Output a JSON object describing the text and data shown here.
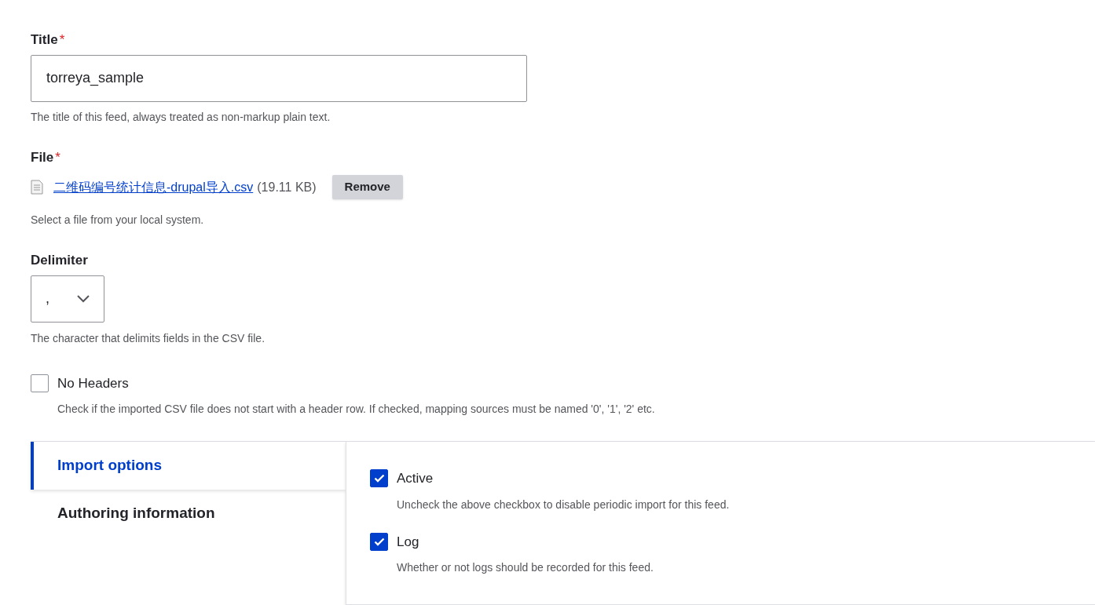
{
  "title_field": {
    "label": "Title",
    "required_mark": "*",
    "value": "torreya_sample",
    "description": "The title of this feed, always treated as non-markup plain text."
  },
  "file_field": {
    "label": "File",
    "required_mark": "*",
    "file_name": "二维码编号统计信息-drupal导入.csv",
    "file_size": "(19.11 KB)",
    "remove_button": "Remove",
    "description": "Select a file from your local system."
  },
  "delimiter_field": {
    "label": "Delimiter",
    "value": ",",
    "description": "The character that delimits fields in the CSV file."
  },
  "no_headers": {
    "label": "No Headers",
    "checked": false,
    "description": "Check if the imported CSV file does not start with a header row. If checked, mapping sources must be named '0', '1', '2' etc."
  },
  "vertical_tabs": [
    {
      "label": "Import options",
      "selected": true
    },
    {
      "label": "Authoring information",
      "selected": false
    }
  ],
  "import_options": [
    {
      "label": "Active",
      "checked": true,
      "description": "Uncheck the above checkbox to disable periodic import for this feed."
    },
    {
      "label": "Log",
      "checked": true,
      "description": "Whether or not logs should be recorded for this feed."
    }
  ]
}
